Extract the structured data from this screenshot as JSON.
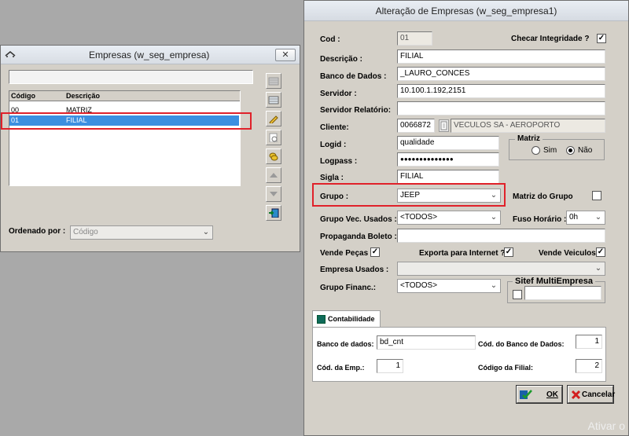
{
  "left_window": {
    "title": "Empresas (w_seg_empresa)",
    "close_label": "✕",
    "columns": [
      "Código",
      "Descrição"
    ],
    "rows": [
      {
        "codigo": "00",
        "descricao": "MATRIZ"
      },
      {
        "codigo": "01",
        "descricao": "FILIAL"
      }
    ],
    "order_label": "Ordenado por :",
    "order_value": "Código"
  },
  "right_window": {
    "title": "Alteração de Empresas (w_seg_empresa1)",
    "labels": {
      "cod": "Cod :",
      "checar": "Checar Integridade  ?",
      "descricao": "Descrição :",
      "banco": "Banco de Dados :",
      "servidor": "Servidor :",
      "servidor_rel": "Servidor Relatório:",
      "cliente": "Cliente:",
      "logid": "Logid :",
      "logpass": "Logpass :",
      "sigla": "Sigla :",
      "matriz": "Matriz",
      "sim": "Sim",
      "nao": "Não",
      "grupo": "Grupo :",
      "matriz_grupo": "Matriz do Grupo",
      "grupo_vec": "Grupo Vec. Usados :",
      "fuso": "Fuso Horário :",
      "propaganda": "Propaganda Boleto :",
      "vende_pecas": "Vende Peças",
      "exporta": "Exporta para Internet ?",
      "vende_veiculos": "Vende Veiculos",
      "empresa_usados": "Empresa Usados :",
      "grupo_financ": "Grupo Financ.:",
      "sitef": "Sitef MultiEmpresa"
    },
    "values": {
      "cod": "01",
      "descricao": "FILIAL",
      "banco": "_LAURO_CONCES",
      "servidor": "10.100.1.192,2151",
      "servidor_rel": "",
      "cliente_code": "0066872",
      "cliente_name": "VECULOS SA - AEROPORTO",
      "logid": "qualidade",
      "logpass": "●●●●●●●●●●●●●●",
      "sigla": "FILIAL",
      "grupo": "JEEP",
      "grupo_vec": "<TODOS>",
      "fuso": "0h",
      "propaganda": "",
      "empresa_usados": "",
      "grupo_financ": "<TODOS>",
      "sitef": "",
      "matriz_selected": "Não"
    },
    "checks": {
      "checar": "✓",
      "vende_pecas": "✓",
      "exporta": "✓",
      "vende_veiculos": "✓",
      "matriz_grupo": "",
      "sitef": ""
    },
    "tab_label": "Contabilidade",
    "contab_labels": {
      "banco": "Banco de dados:",
      "cod_banco": "Cód. do Banco de Dados:",
      "cod_emp": "Cód. da Emp.:",
      "cod_filial": "Código da Filial:"
    },
    "contab_values": {
      "banco": "bd_cnt",
      "cod_banco": "1",
      "cod_emp": "1",
      "cod_filial": "2"
    },
    "ok_label": "OK",
    "cancel_label": "Cancelar"
  },
  "watermark": "Ativar o",
  "colors": {
    "selection": "#3c8fe0",
    "highlight_box": "#e0212a"
  }
}
